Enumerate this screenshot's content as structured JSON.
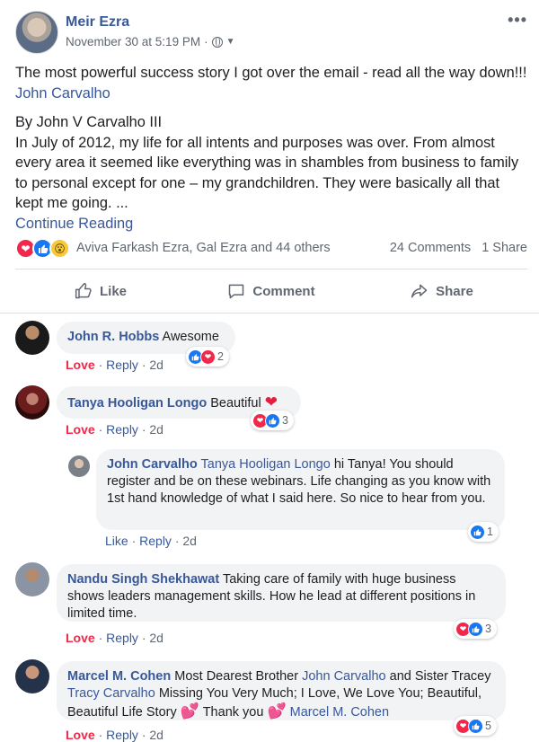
{
  "post": {
    "author": "Meir Ezra",
    "date": "November 30 at 5:19 PM",
    "separator": "·",
    "more": "•••",
    "text_line": "The most powerful success story I got over the email - read all the way down!!!",
    "tagged": "John Carvalho",
    "byline": "By John V Carvalho III",
    "story": "In July of 2012, my life for all intents and purposes was over. From almost every area it seemed like everything was in shambles from business to family to personal except for one – my grandchildren. They were basically all that kept me going. ...",
    "continue_reading": "Continue Reading"
  },
  "reactions": {
    "names": "Aviva Farkash Ezra, Gal Ezra and 44 others",
    "comments": "24 Comments",
    "shares": "1 Share",
    "colors": {
      "love": "#f0284a",
      "like": "#1877f2",
      "wow": "#f7c83a"
    }
  },
  "actions": {
    "like": "Like",
    "comment": "Comment",
    "share": "Share"
  },
  "comments": [
    {
      "name": "John R. Hobbs",
      "text": "Awesome",
      "love": "Love",
      "reply": "Reply",
      "time": "2d",
      "count": "2"
    },
    {
      "name": "Tanya Hooligan Longo",
      "text": "Beautiful",
      "emoji": "❤",
      "love": "Love",
      "reply": "Reply",
      "time": "2d",
      "count": "3"
    },
    {
      "name": "John Carvalho",
      "mention": "Tanya Hooligan Longo",
      "text": "hi Tanya! You should register and be on these webinars. Life changing as you know with 1st hand knowledge of what I said here. So nice to hear from you.",
      "like": "Like",
      "reply": "Reply",
      "time": "2d",
      "count": "1"
    },
    {
      "name": "Nandu Singh Shekhawat",
      "text": "Taking care of family with huge business shows leaders management skills. How he lead at different positions in limited time.",
      "love": "Love",
      "reply": "Reply",
      "time": "2d",
      "count": "3"
    },
    {
      "name": "Marcel M. Cohen",
      "text1": "Most Dearest Brother",
      "mention1": "John Carvalho",
      "text2": "and Sister Tracey",
      "mention2": "Tracy Carvalho",
      "text3": "Missing You Very Much; I Love, We Love You; Beautiful, Beautiful Life Story",
      "emoji": "💕",
      "text4": "Thank you",
      "mention3": "Marcel M. Cohen",
      "love": "Love",
      "reply": "Reply",
      "time": "2d",
      "count": "5"
    }
  ]
}
